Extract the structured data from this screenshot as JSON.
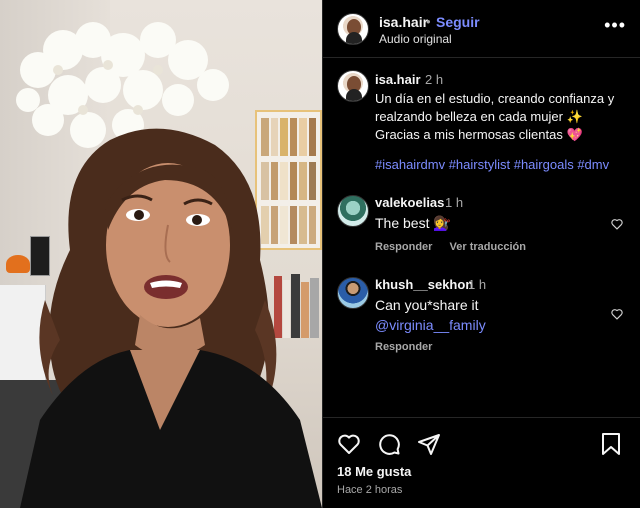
{
  "header": {
    "username": "isa.hair",
    "separator": "•",
    "follow_label": "Seguir",
    "audio_label": "Audio original",
    "more_icon": "more-horizontal-icon"
  },
  "caption": {
    "username": "isa.hair",
    "time": "2 h",
    "text": "Un día en el estudio, creando confianza y realzando belleza en cada mujer ✨\n Gracias a mis hermosas clientas 💖",
    "hashtags": "#isahairdmv #hairstylist #hairgoals #dmv"
  },
  "comments": [
    {
      "username": "valekoelias",
      "time": "1 h",
      "text": "The best 💇‍♀️",
      "actions": [
        "Responder",
        "Ver traducción"
      ]
    },
    {
      "username": "khush__sekhon",
      "time": "1 h",
      "text": "Can you*share it",
      "mention": "@virginia__family",
      "actions": [
        "Responder"
      ]
    }
  ],
  "footer": {
    "likes": "18 Me gusta",
    "time_ago": "Hace 2 horas",
    "icons": [
      "heart-icon",
      "comment-icon",
      "share-icon",
      "bookmark-icon"
    ]
  },
  "colors": {
    "background": "#000000",
    "link": "#7c8cff",
    "muted": "#a8a8a8",
    "text": "#f5f5f5"
  }
}
